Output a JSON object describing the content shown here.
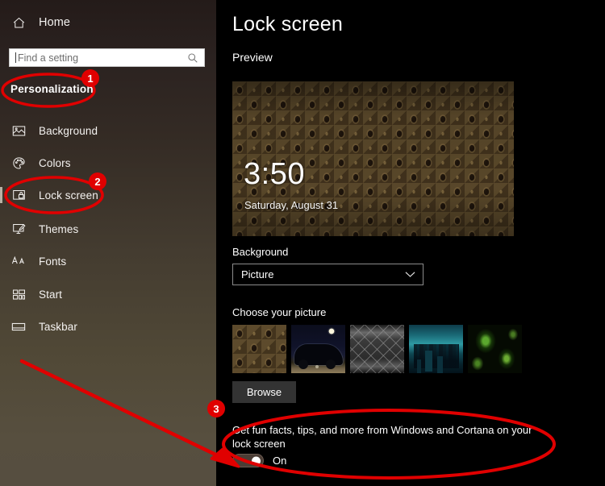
{
  "sidebar": {
    "home": {
      "label": "Home",
      "icon": "home-icon"
    },
    "search": {
      "placeholder": "Find a setting",
      "icon": "search-icon"
    },
    "category": "Personalization",
    "items": [
      {
        "label": "Background",
        "icon": "picture-icon",
        "selected": false
      },
      {
        "label": "Colors",
        "icon": "palette-icon",
        "selected": false
      },
      {
        "label": "Lock screen",
        "icon": "lock-screen-icon",
        "selected": true
      },
      {
        "label": "Themes",
        "icon": "themes-icon",
        "selected": false
      },
      {
        "label": "Fonts",
        "icon": "fonts-icon",
        "selected": false
      },
      {
        "label": "Start",
        "icon": "start-tiles-icon",
        "selected": false
      },
      {
        "label": "Taskbar",
        "icon": "taskbar-icon",
        "selected": false
      }
    ]
  },
  "main": {
    "title": "Lock screen",
    "preview_label": "Preview",
    "preview": {
      "time": "3:50",
      "date": "Saturday, August 31"
    },
    "background": {
      "label": "Background",
      "selected": "Picture",
      "chevron": "chevron-down-icon"
    },
    "choose_picture": {
      "label": "Choose your picture",
      "thumbnails": [
        {
          "name": "damask-brown",
          "selected": true
        },
        {
          "name": "vintage-car-night",
          "selected": false
        },
        {
          "name": "gray-lattice",
          "selected": false
        },
        {
          "name": "teal-cityscape",
          "selected": false
        },
        {
          "name": "green-abstract",
          "selected": false
        }
      ],
      "browse_label": "Browse"
    },
    "cortana": {
      "description": "Get fun facts, tips, and more from Windows and Cortana on your lock screen",
      "state": "On"
    }
  },
  "annotations": {
    "color": "#e00000",
    "badges": [
      {
        "number": "1",
        "target": "Personalization"
      },
      {
        "number": "2",
        "target": "Lock screen"
      },
      {
        "number": "3",
        "target": "Cortana lock screen toggle"
      }
    ],
    "shapes": [
      {
        "type": "ellipse",
        "around": "personalization-category"
      },
      {
        "type": "ellipse",
        "around": "sidebar-item-lock-screen"
      },
      {
        "type": "ellipse",
        "around": "cortana-toggle-section"
      },
      {
        "type": "arrow",
        "points_to": "cortana-toggle"
      }
    ]
  }
}
